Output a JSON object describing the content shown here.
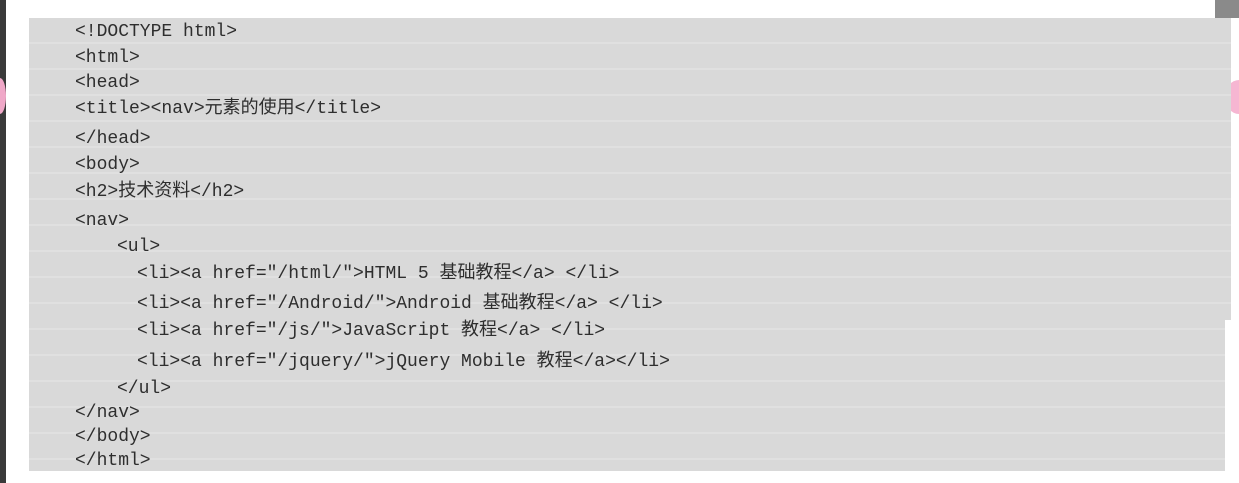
{
  "code_lines": [
    "<!DOCTYPE html>",
    "<html>",
    "<head>",
    "<title><nav>元素的使用</title>",
    "</head>",
    "<body>",
    "<h2>技术资料</h2>",
    "<nav>",
    "<ul>",
    "<li><a href=\"/html/\">HTML 5 基础教程</a> </li>",
    "<li><a href=\"/Android/\">Android 基础教程</a> </li>",
    "<li><a href=\"/js/\">JavaScript 教程</a> </li>",
    "<li><a href=\"/jquery/\">jQuery Mobile 教程</a></li>",
    "</ul>",
    "</nav>",
    "</body>",
    "</html>"
  ]
}
